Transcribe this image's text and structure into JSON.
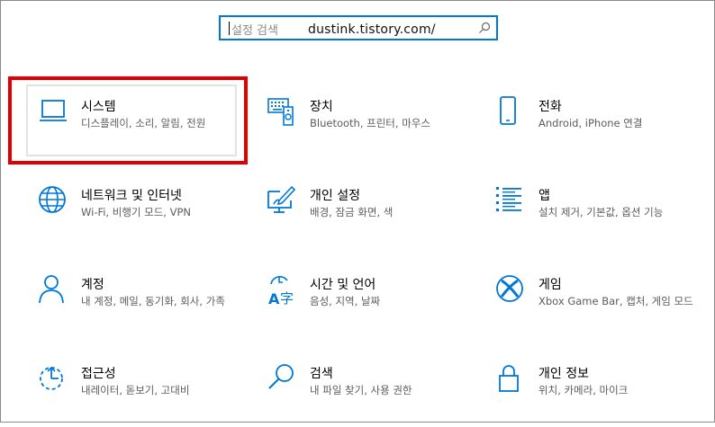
{
  "search": {
    "placeholder": "설정 검색",
    "overlay_text": "dustink.tistory.com/"
  },
  "accent_color": "#0078d7",
  "highlight_color": "#e00000",
  "tiles": [
    {
      "title": "시스템",
      "desc": "디스플레이, 소리, 알림, 전원",
      "icon": "laptop-icon",
      "highlighted": true
    },
    {
      "title": "장치",
      "desc": "Bluetooth, 프린터, 마우스",
      "icon": "devices-icon"
    },
    {
      "title": "전화",
      "desc": "Android, iPhone 연결",
      "icon": "phone-icon"
    },
    {
      "title": "네트워크 및 인터넷",
      "desc": "Wi-Fi, 비행기 모드, VPN",
      "icon": "globe-icon"
    },
    {
      "title": "개인 설정",
      "desc": "배경, 잠금 화면, 색",
      "icon": "personalization-icon"
    },
    {
      "title": "앱",
      "desc": "설치 제거, 기본값, 옵션 기능",
      "icon": "apps-list-icon"
    },
    {
      "title": "계정",
      "desc": "내 계정, 메일, 동기화, 회사, 가족",
      "icon": "person-icon"
    },
    {
      "title": "시간 및 언어",
      "desc": "음성, 지역, 날짜",
      "icon": "time-language-icon"
    },
    {
      "title": "게임",
      "desc": "Xbox Game Bar, 캡처, 게임 모드",
      "icon": "xbox-icon"
    },
    {
      "title": "접근성",
      "desc": "내레이터, 돋보기, 고대비",
      "icon": "ease-of-access-icon"
    },
    {
      "title": "검색",
      "desc": "내 파일 찾기, 사용 권한",
      "icon": "search-icon"
    },
    {
      "title": "개인 정보",
      "desc": "위치, 카메라, 마이크",
      "icon": "lock-icon"
    }
  ]
}
